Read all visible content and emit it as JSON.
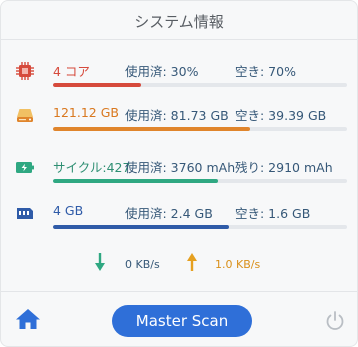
{
  "window": {
    "title": "システム情報"
  },
  "colors": {
    "cpu": "#d64a3c",
    "disk": "#e0852c",
    "battery": "#2fa882",
    "memory": "#2f5ba8",
    "download": "#2fa882",
    "upload": "#e5a020",
    "accent": "#2f6fd8",
    "label": "#365878"
  },
  "cpu": {
    "icon": "cpu-chip-icon",
    "primary": "4 コア",
    "used": "使用済: 30%",
    "free": "空き: 70%",
    "used_fraction": 0.3
  },
  "disk": {
    "icon": "hard-drive-icon",
    "primary": "121.12 GB",
    "used": "使用済: 81.73 GB",
    "free": "空き: 39.39 GB",
    "used_fraction": 0.67
  },
  "battery": {
    "icon": "battery-icon",
    "primary": "サイクル:427",
    "used": "使用済: 3760 mAh",
    "free": "残り: 2910 mAh",
    "used_fraction": 0.56
  },
  "memory": {
    "icon": "memory-icon",
    "primary": "4 GB",
    "used": "使用済: 2.4 GB",
    "free": "空き: 1.6 GB",
    "used_fraction": 0.6
  },
  "network": {
    "download": {
      "icon": "download-arrow-icon",
      "value": "0 KB/s"
    },
    "upload": {
      "icon": "upload-arrow-icon",
      "value": "1.0 KB/s"
    }
  },
  "footer": {
    "home_icon": "home-icon",
    "scan_label": "Master Scan",
    "power_icon": "power-icon"
  }
}
